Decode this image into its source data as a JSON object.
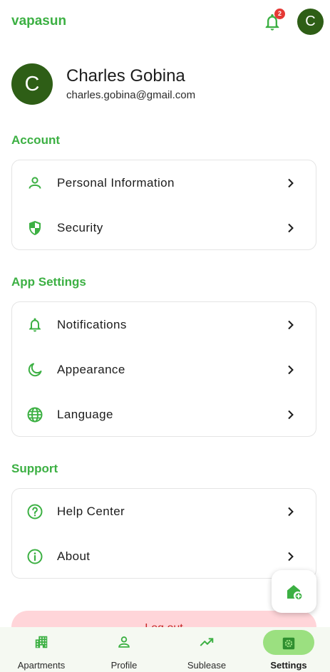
{
  "app": {
    "brand": "vapasun",
    "notification_count": "2",
    "avatar_initial": "C"
  },
  "profile": {
    "initial": "C",
    "name": "Charles Gobina",
    "email": "charles.gobina@gmail.com"
  },
  "sections": {
    "account": {
      "title": "Account",
      "items": [
        {
          "label": "Personal Information",
          "icon": "person-icon"
        },
        {
          "label": "Security",
          "icon": "shield-icon"
        }
      ]
    },
    "app_settings": {
      "title": "App Settings",
      "items": [
        {
          "label": "Notifications",
          "icon": "bell-icon"
        },
        {
          "label": "Appearance",
          "icon": "moon-icon"
        },
        {
          "label": "Language",
          "icon": "globe-icon"
        }
      ]
    },
    "support": {
      "title": "Support",
      "items": [
        {
          "label": "Help Center",
          "icon": "help-circle-icon"
        },
        {
          "label": "About",
          "icon": "info-icon"
        }
      ]
    }
  },
  "logout": {
    "label": "Log out"
  },
  "fab": {
    "icon": "add-home-icon"
  },
  "nav": {
    "items": [
      {
        "label": "Apartments",
        "icon": "apartment-icon"
      },
      {
        "label": "Profile",
        "icon": "person-icon"
      },
      {
        "label": "Sublease",
        "icon": "trending-up-icon"
      },
      {
        "label": "Settings",
        "icon": "settings-icon",
        "active": true
      }
    ]
  },
  "colors": {
    "accent": "#3cb043",
    "avatar": "#2e5e16",
    "active_pill": "#9be080",
    "badge": "#e53935",
    "logout_bg": "#ffd5d9",
    "logout_text": "#c62828"
  }
}
